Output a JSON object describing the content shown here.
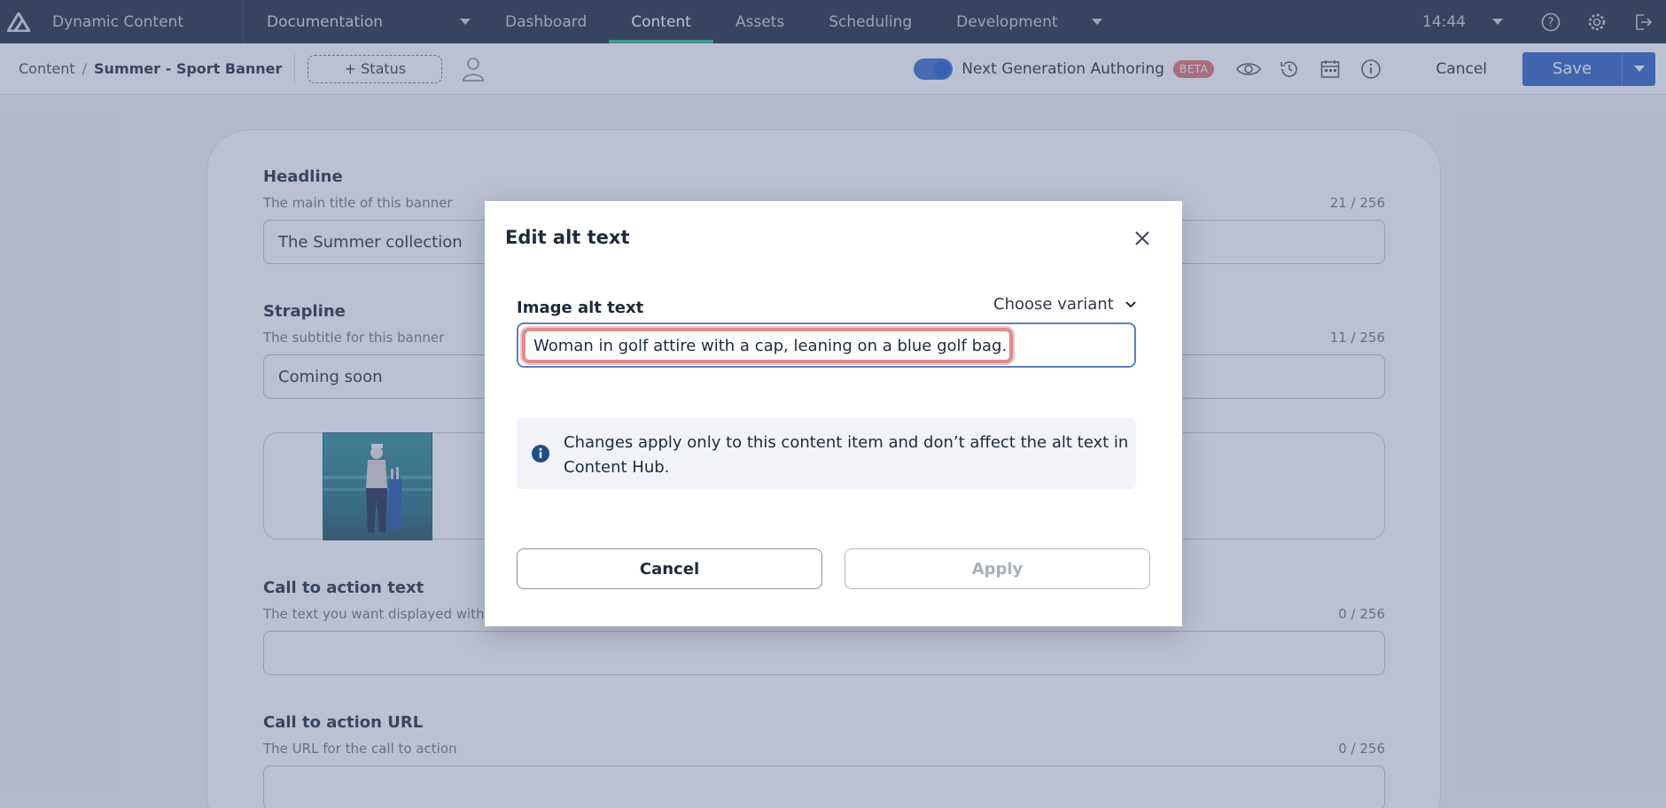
{
  "topnav": {
    "app_name": "Dynamic Content",
    "hub": "Documentation",
    "tabs": [
      {
        "label": "Dashboard",
        "active": false
      },
      {
        "label": "Content",
        "active": true
      },
      {
        "label": "Assets",
        "active": false
      },
      {
        "label": "Scheduling",
        "active": false
      },
      {
        "label": "Development",
        "active": false
      }
    ],
    "time": "14:44",
    "icons": [
      "help-icon",
      "gear-icon",
      "logout-icon"
    ],
    "accent": "#2fb38c"
  },
  "subbar": {
    "breadcrumb_root": "Content",
    "breadcrumb_sep": "/",
    "breadcrumb_current": "Summer - Sport Banner",
    "status_button": "+ Status",
    "toggle_label": "Next Generation Authoring",
    "beta_badge": "BETA",
    "cancel_label": "Cancel",
    "save_label": "Save",
    "save_color": "#2d62c2"
  },
  "form": {
    "headline": {
      "label": "Headline",
      "description": "The main title of this banner",
      "count": "21 / 256",
      "value": "The Summer collection"
    },
    "strapline": {
      "label": "Strapline",
      "description": "The subtitle for this banner",
      "count": "11 / 256",
      "value": "Coming soon"
    },
    "cta_text": {
      "label": "Call to action text",
      "description": "The text you want displayed with the",
      "count": "0 / 256",
      "value": ""
    },
    "cta_url": {
      "label": "Call to action URL",
      "description": "The URL for the call to action",
      "count": "0 / 256",
      "value": ""
    }
  },
  "modal": {
    "title": "Edit alt text",
    "alt_label": "Image alt text",
    "variant_label": "Choose variant",
    "alt_value": "Woman in golf attire with a cap, leaning on a blue golf bag.",
    "info": "Changes apply only to this content item and don’t affect the alt text in Content Hub.",
    "cancel_label": "Cancel",
    "apply_label": "Apply"
  }
}
